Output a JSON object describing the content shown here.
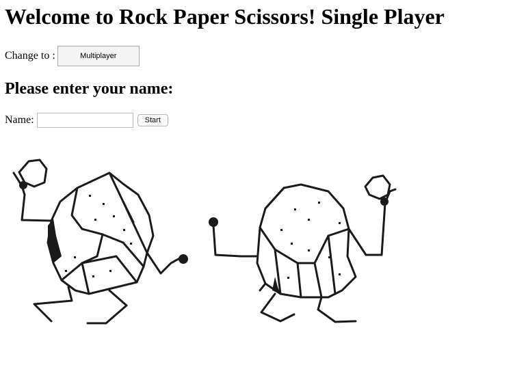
{
  "header": {
    "title": "Welcome to Rock Paper Scissors! Single Player"
  },
  "mode_switch": {
    "label": "Change to :",
    "button_label": "Multiplayer"
  },
  "name_section": {
    "heading": "Please enter your name:",
    "field_label": "Name:",
    "field_value": "",
    "field_placeholder": "",
    "start_label": "Start"
  },
  "illustration": {
    "subject": "two-dancing-rocks-drawing"
  },
  "colors": {
    "background": "#ffffff",
    "text": "#000000",
    "button_bg": "#f4f4f4",
    "button_border": "#a9a9a9"
  }
}
